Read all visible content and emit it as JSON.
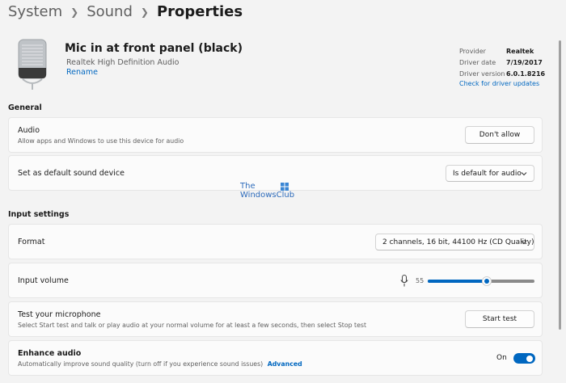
{
  "breadcrumb": {
    "items": [
      "System",
      "Sound"
    ],
    "current": "Properties"
  },
  "device": {
    "name": "Mic in at front panel (black)",
    "subtitle": "Realtek High Definition Audio",
    "rename": "Rename"
  },
  "driver": {
    "provider_label": "Provider",
    "provider_value": "Realtek",
    "date_label": "Driver date",
    "date_value": "7/19/2017",
    "version_label": "Driver version",
    "version_value": "6.0.1.8216",
    "update_link": "Check for driver updates"
  },
  "general": {
    "title": "General",
    "audio": {
      "title": "Audio",
      "desc": "Allow apps and Windows to use this device for audio",
      "button": "Don't allow"
    },
    "default": {
      "title": "Set as default sound device",
      "value": "Is default for audio"
    }
  },
  "watermark": {
    "line1": "The",
    "line2": "WindowsClub"
  },
  "input": {
    "title": "Input settings",
    "format": {
      "title": "Format",
      "value": "2 channels, 16 bit, 44100 Hz (CD Quality)"
    },
    "volume": {
      "title": "Input volume",
      "value": "55",
      "level": 0.55
    },
    "test": {
      "title": "Test your microphone",
      "desc": "Select Start test and talk or play audio at your normal volume for at least a few seconds, then select Stop test",
      "button": "Start test"
    },
    "enhance": {
      "title": "Enhance audio",
      "desc": "Automatically improve sound quality (turn off if you experience sound issues)",
      "link": "Advanced",
      "state": "On"
    }
  },
  "colors": {
    "accent": "#0067c0",
    "background": "#f3f3f3",
    "card": "#fbfbfb"
  }
}
